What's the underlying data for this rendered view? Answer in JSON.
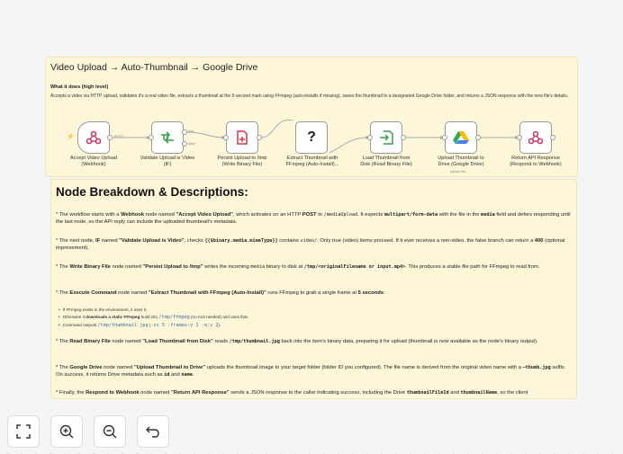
{
  "header": {
    "title": "Video Upload → Auto-Thumbnail → Google Drive",
    "subtitle": "What it does (high level)",
    "description": "Accepts a video via HTTP upload, validates it's a real video file, extracts a thumbnail at the 5-second mark using FFmpeg (auto-installs if missing), saves the thumbnail to a designated Google Drive folder, and returns a JSON response with the new file's details."
  },
  "workflow": {
    "nodes": [
      {
        "label1": "Accept Video Upload",
        "label2": "(Webhook)",
        "icon": "webhook-icon"
      },
      {
        "label1": "Validate Upload is Video",
        "label2": "(IF)",
        "icon": "branch-icon"
      },
      {
        "label1": "Persist Upload to /tmp",
        "label2": "(Write Binary File)",
        "icon": "file-write-icon"
      },
      {
        "label1": "Extract Thumbnail with",
        "label2": "FFmpeg (Auto-Install)...",
        "icon": "question-icon",
        "glyph": "?"
      },
      {
        "label1": "Load Thumbnail from",
        "label2": "Disk (Read Binary File)",
        "icon": "file-read-icon"
      },
      {
        "label1": "Upload Thumbnail to",
        "label2": "Drive (Google Drive)",
        "icon": "google-drive-icon"
      },
      {
        "label1": "Return API Response",
        "label2": "(Respond to Webhook)",
        "icon": "webhook-icon"
      }
    ],
    "edge_labels": {
      "post": "POST",
      "true": "true",
      "false": "false",
      "upload": "upload file"
    }
  },
  "breakdown": {
    "heading": "Node Breakdown & Descriptions:",
    "p1": {
      "a": "* The workflow starts with a ",
      "b": "Webhook",
      "c": " node named ",
      "d": "\"Accept Video Upload\"",
      "e": ", which activates on an HTTP ",
      "f": "POST",
      "g": " to ",
      "h": "/mediaUpload",
      "i": ". It expects ",
      "j": "multipart/form-data",
      "k": " with the file in the ",
      "l": "media",
      "m": " field and defers responding until the last node, so the API reply can include the uploaded thumbnail's metadata."
    },
    "p2": {
      "a": "* The next node, ",
      "b": "IF",
      "c": " named ",
      "d": "\"Validate Upload is Video\"",
      "e": ", checks ",
      "f": "{{$binary.media.mimeType}}",
      "g": " contains ",
      "h": "video/",
      "i": ". Only true (video) items proceed. If it ever receives a non-video, the false branch can return a ",
      "j": "400",
      "k": " (optional improvement)."
    },
    "p3": {
      "a": "* The ",
      "b": "Write Binary File",
      "c": " node named ",
      "d": "\"Persist Upload to /tmp\"",
      "e": " writes the incoming ",
      "f": "media",
      "g": " binary to disk at ",
      "h": "/tmp/<originalFilename or input.mp4>",
      "i": ". This produces a stable file path for FFmpeg to read from."
    },
    "p4": {
      "a": "* The ",
      "b": "Execute Command",
      "c": " node named ",
      "d": "\"Extract Thumbnail with FFmpeg (Auto-Install)\"",
      "e": " runs FFmpeg to grab a single frame at ",
      "f": "5 seconds",
      "g": ":"
    },
    "list": {
      "l1": "If FFmpeg exists in the environment, it uses it.",
      "l2a": "Otherwise it ",
      "l2b": "downloads a static FFmpeg",
      "l2c": " build into ",
      "l2d": "/tmp/ffmpeg",
      "l2e": " (no root needed) and uses that.",
      "l3a": "Command outputs ",
      "l3b": "/tmp/thumbnail.jpg",
      "l3c": " (",
      "l3d": "-ss 5 -frames:v 1 -q:v 2",
      "l3e": ")."
    },
    "p5": {
      "a": "* The ",
      "b": "Read Binary File",
      "c": " node named ",
      "d": "\"Load Thumbnail from Disk\"",
      "e": " reads ",
      "f": "/tmp/thumbnail.jpg",
      "g": " back into the item's binary data, preparing it for upload (thumbnail is now available as the node's binary output)."
    },
    "p6": {
      "a": "* The ",
      "b": "Google Drive",
      "c": " node named ",
      "d": "\"Upload Thumbnail to Drive\"",
      "e": " uploads the thumbnail image to your target folder (folder ID you configured). The file name is derived from the original video name with a ",
      "f": "–thumb.jpg",
      "g": " suffix. On success, it returns Drive metadata such as ",
      "h": "id",
      "i": " and ",
      "j": "name",
      "k": "."
    },
    "p7": {
      "a": "* Finally, the ",
      "b": "Respond to Webhook",
      "c": " node named ",
      "d": "\"Return API Response\"",
      "e": " sends a JSON response to the caller indicating success, including the Drive ",
      "f": "thumbnailFileId",
      "g": " and ",
      "h": "thumbnailName",
      "i": ", so the client"
    }
  },
  "controls": {
    "fit": "fit-view-icon",
    "zoom_in": "zoom-in-icon",
    "zoom_out": "zoom-out-icon",
    "undo": "undo-icon"
  }
}
